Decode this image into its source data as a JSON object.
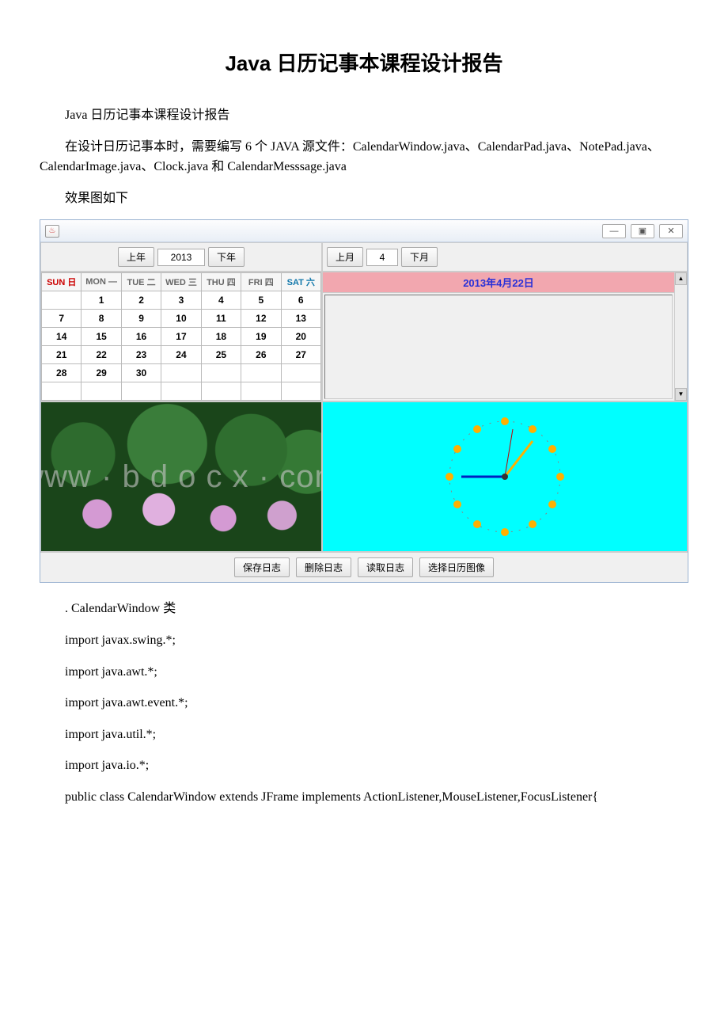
{
  "title": "Java 日历记事本课程设计报告",
  "intro_line": "Java 日历记事本课程设计报告",
  "description": "在设计日历记事本时，需要编写 6 个 JAVA 源文件：CalendarWindow.java、CalendarPad.java、NotePad.java、CalendarImage.java、Clock.java 和 CalendarMesssage.java",
  "effect_label": "效果图如下",
  "app": {
    "win_min": "—",
    "win_max": "▣",
    "win_close": "✕",
    "prev_year": "上年",
    "year_value": "2013",
    "next_year": "下年",
    "prev_month": "上月",
    "month_value": "4",
    "next_month": "下月",
    "date_banner": "2013年4月22日",
    "headers": [
      "SUN 日",
      "MON —",
      "TUE 二",
      "WED 三",
      "THU 四",
      "FRI 四",
      "SAT 六"
    ],
    "rows": [
      [
        "",
        "1",
        "2",
        "3",
        "4",
        "5",
        "6"
      ],
      [
        "7",
        "8",
        "9",
        "10",
        "11",
        "12",
        "13"
      ],
      [
        "14",
        "15",
        "16",
        "17",
        "18",
        "19",
        "20"
      ],
      [
        "21",
        "22",
        "23",
        "24",
        "25",
        "26",
        "27"
      ],
      [
        "28",
        "29",
        "30",
        "",
        "",
        "",
        ""
      ],
      [
        "",
        "",
        "",
        "",
        "",
        "",
        ""
      ]
    ],
    "btn_save": "保存日志",
    "btn_delete": "删除日志",
    "btn_read": "读取日志",
    "btn_choose_img": "选择日历图像",
    "watermark": "www · b d o c x · com"
  },
  "code": {
    "l1": ". CalendarWindow 类",
    "l2": "import javax.swing.*;",
    "l3": "import java.awt.*;",
    "l4": "import java.awt.event.*;",
    "l5": "import java.util.*;",
    "l6": "import java.io.*;",
    "l7": "public class CalendarWindow extends JFrame implements ActionListener,MouseListener,FocusListener{"
  }
}
